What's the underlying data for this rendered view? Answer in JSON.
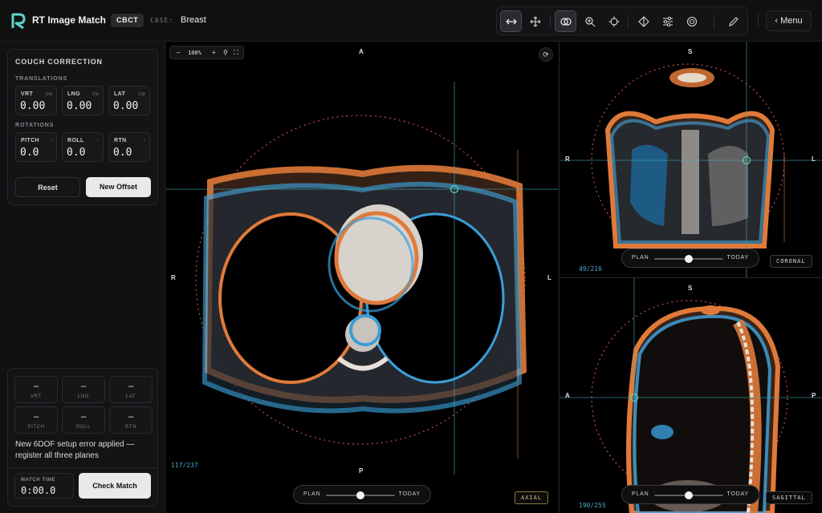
{
  "app": {
    "title": "RT Image Match",
    "logo_icon": "logo-r-icon"
  },
  "header": {
    "mode": "CBCT",
    "case_label": "CASE:",
    "case_value": "Breast",
    "menu_label": "‹ Menu",
    "tools": [
      {
        "icon": "swap-horizontal-icon",
        "active": true
      },
      {
        "icon": "move-icon",
        "active": false
      },
      {
        "icon": "overlay-icon",
        "active": true
      },
      {
        "icon": "zoom-icon",
        "active": false
      },
      {
        "icon": "crosshair-icon",
        "active": false
      },
      {
        "icon": "landmark-icon",
        "active": false
      },
      {
        "icon": "sliders-icon",
        "active": false
      },
      {
        "icon": "target-icon",
        "active": false
      },
      {
        "icon": "pen-icon",
        "active": false
      }
    ]
  },
  "couch": {
    "title": "COUCH CORRECTION",
    "translations_label": "TRANSLATIONS",
    "rotations_label": "ROTATIONS",
    "translations": [
      {
        "label": "VRT",
        "unit": "CM",
        "value": "0.00"
      },
      {
        "label": "LNG",
        "unit": "CM",
        "value": "0.00"
      },
      {
        "label": "LAT",
        "unit": "CM",
        "value": "0.00"
      }
    ],
    "rotations": [
      {
        "label": "PITCH",
        "unit": "°",
        "value": "0.0"
      },
      {
        "label": "ROLL",
        "unit": "°",
        "value": "0.0"
      },
      {
        "label": "RTN",
        "unit": "°",
        "value": "0.0"
      }
    ],
    "reset_label": "Reset",
    "new_offset_label": "New Offset"
  },
  "result": {
    "boxes": [
      {
        "value": "–",
        "label": "VRT"
      },
      {
        "value": "–",
        "label": "LNG"
      },
      {
        "value": "–",
        "label": "LAT"
      },
      {
        "value": "–",
        "label": "PITCH"
      },
      {
        "value": "–",
        "label": "ROLL"
      },
      {
        "value": "–",
        "label": "RTN"
      }
    ],
    "message": "New 6DOF setup error applied — register all three planes",
    "match_time_label": "MATCH TIME",
    "match_time_value": "0:00.0",
    "check_label": "Check Match"
  },
  "axial": {
    "zoom": "100%",
    "zoom_minus": "–",
    "zoom_plus": "+",
    "orient": {
      "top": "A",
      "bottom": "P",
      "left": "R",
      "right": "L"
    },
    "slice": "117/237",
    "tag": "AXIAL",
    "blend_left": "PLAN",
    "blend_right": "TODAY",
    "blend_ratio": 0.5
  },
  "coronal": {
    "orient": {
      "top": "S",
      "left": "R",
      "right": "L"
    },
    "slice": "49/216",
    "tag": "CORONAL",
    "blend_left": "PLAN",
    "blend_right": "TODAY",
    "blend_ratio": 0.5
  },
  "sagittal": {
    "orient": {
      "top": "S",
      "left": "A",
      "right": "P"
    },
    "slice": "190/255",
    "tag": "SAGITTAL",
    "blend_left": "PLAN",
    "blend_right": "TODAY",
    "blend_ratio": 0.5
  },
  "colors": {
    "plan": "#e07a3a",
    "today": "#3b9ed8",
    "crosshair": "#3fa9b5",
    "roi": "#c0504d"
  }
}
